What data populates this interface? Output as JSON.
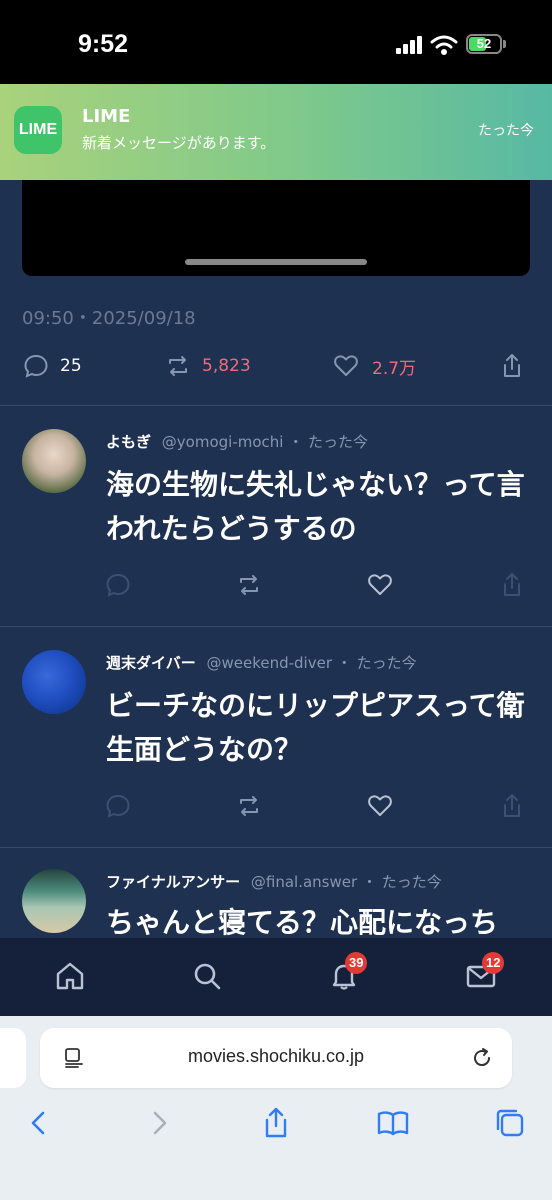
{
  "status_bar": {
    "time": "9:52",
    "battery": "52"
  },
  "notification": {
    "app_logo": "LIME",
    "app_name": "LIME",
    "message": "新着メッセージがあります。",
    "time": "たった今"
  },
  "focused_post": {
    "datetime": "09:50・2025/09/18",
    "replies": "25",
    "reposts": "5,823",
    "likes": "2.7万"
  },
  "posts": [
    {
      "name": "よもぎ",
      "handle": "@yomogi-mochi",
      "sep": "・",
      "time": "たった今",
      "text": "海の生物に失礼じゃない？って言われたらどうするの"
    },
    {
      "name": "週末ダイバー",
      "handle": "@weekend-diver",
      "sep": "・",
      "time": "たった今",
      "text": "ビーチなのにリップピアスって衛生面どうなの？"
    },
    {
      "name": "ファイナルアンサー",
      "handle": "@final.answer",
      "sep": "・",
      "time": "たった今",
      "text": "ちゃんと寝てる？心配になっち"
    }
  ],
  "tab_bar": {
    "notifications_badge": "39",
    "messages_badge": "12"
  },
  "browser": {
    "url": "movies.shochiku.co.jp"
  },
  "colors": {
    "background": "#1f3150",
    "repost_accent": "#f06b7a",
    "badge": "#e53935"
  },
  "icons": [
    "home-icon",
    "search-icon",
    "bell-icon",
    "mail-icon",
    "reply-icon",
    "repost-icon",
    "heart-icon",
    "share-icon",
    "back-icon",
    "forward-icon",
    "bookmarks-icon",
    "tabs-icon",
    "reload-icon",
    "reader-icon"
  ]
}
